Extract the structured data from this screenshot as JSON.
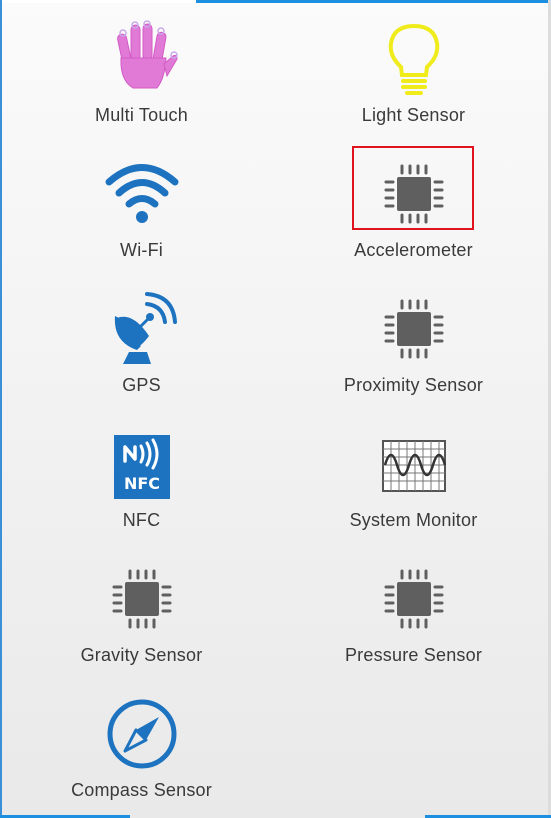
{
  "tiles": [
    {
      "label": "Multi Touch",
      "icon": "hand-icon"
    },
    {
      "label": "Light Sensor",
      "icon": "lightbulb-icon"
    },
    {
      "label": "Wi-Fi",
      "icon": "wifi-icon"
    },
    {
      "label": "Accelerometer",
      "icon": "chip-icon"
    },
    {
      "label": "GPS",
      "icon": "satellite-dish-icon"
    },
    {
      "label": "Proximity Sensor",
      "icon": "chip-icon"
    },
    {
      "label": "NFC",
      "icon": "nfc-icon",
      "icon_text": "NFC"
    },
    {
      "label": "System Monitor",
      "icon": "oscilloscope-icon"
    },
    {
      "label": "Gravity Sensor",
      "icon": "chip-icon"
    },
    {
      "label": "Pressure Sensor",
      "icon": "chip-icon"
    },
    {
      "label": "Compass Sensor",
      "icon": "compass-icon"
    }
  ],
  "colors": {
    "accent_blue": "#1d73c0",
    "hand_pink": "#e07ad6",
    "bulb_yellow": "#f0ec1c",
    "chip_gray": "#5f5f5f",
    "highlight_red": "#e0141e"
  }
}
